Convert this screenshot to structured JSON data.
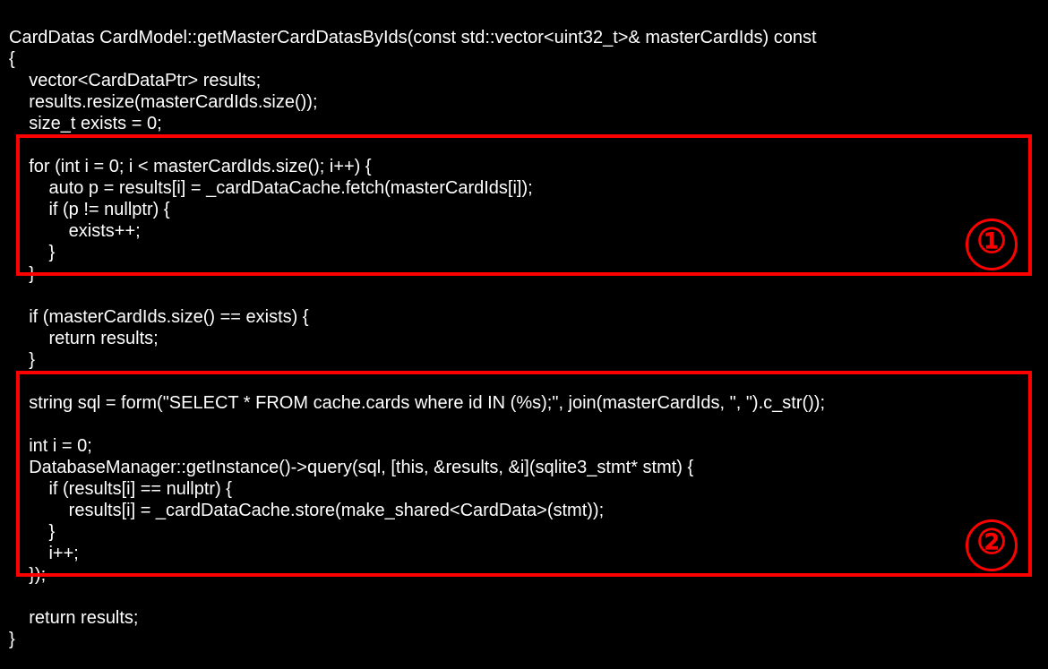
{
  "code": {
    "line01": "CardDatas CardModel::getMasterCardDatasByIds(const std::vector<uint32_t>& masterCardIds) const",
    "line02": "{",
    "line03": "    vector<CardDataPtr> results;",
    "line04": "    results.resize(masterCardIds.size());",
    "line05": "    size_t exists = 0;",
    "line06": "",
    "line07": "    for (int i = 0; i < masterCardIds.size(); i++) {",
    "line08": "        auto p = results[i] = _cardDataCache.fetch(masterCardIds[i]);",
    "line09": "        if (p != nullptr) {",
    "line10": "            exists++;",
    "line11": "        }",
    "line12": "    }",
    "line13": "",
    "line14": "    if (masterCardIds.size() == exists) {",
    "line15": "        return results;",
    "line16": "    }",
    "line17": "",
    "line18": "    string sql = form(\"SELECT * FROM cache.cards where id IN (%s);\", join(masterCardIds, \", \").c_str());",
    "line19": "",
    "line20": "    int i = 0;",
    "line21": "    DatabaseManager::getInstance()->query(sql, [this, &results, &i](sqlite3_stmt* stmt) {",
    "line22": "        if (results[i] == nullptr) {",
    "line23": "            results[i] = _cardDataCache.store(make_shared<CardData>(stmt));",
    "line24": "        }",
    "line25": "        i++;",
    "line26": "    });",
    "line27": "",
    "line28": "    return results;",
    "line29": "}"
  },
  "highlights": {
    "box1_label": "①",
    "box2_label": "②"
  }
}
